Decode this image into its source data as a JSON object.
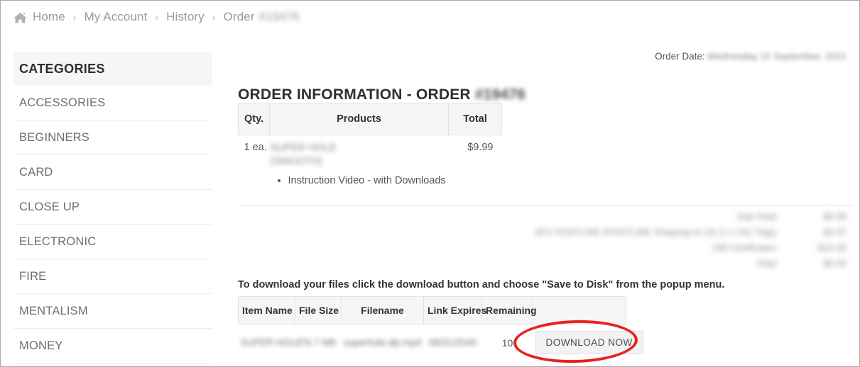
{
  "breadcrumb": {
    "home_icon": "home-icon",
    "separator": "›",
    "items": [
      {
        "label": "Home"
      },
      {
        "label": "My Account"
      },
      {
        "label": "History"
      }
    ],
    "current_label": "Order",
    "current_value_redacted": "#19476"
  },
  "sidebar": {
    "title": "CATEGORIES",
    "items": [
      {
        "label": "ACCESSORIES"
      },
      {
        "label": "BEGINNERS"
      },
      {
        "label": "CARD"
      },
      {
        "label": "CLOSE UP"
      },
      {
        "label": "ELECTRONIC"
      },
      {
        "label": "FIRE"
      },
      {
        "label": "MENTALISM"
      },
      {
        "label": "MONEY"
      }
    ]
  },
  "main": {
    "order_date_label": "Order Date:",
    "order_date_value_redacted": "Wednesday 15 September, 2021",
    "title": "ORDER INFORMATION - ORDER",
    "order_number_redacted": "#19476",
    "products_table": {
      "headers": [
        "Qty.",
        "Products",
        "Total"
      ],
      "rows": [
        {
          "qty": "1 ea.",
          "product_name_redacted_line1": "SUPER HOLE",
          "product_name_redacted_line2": "(SMOOTH)",
          "total": "$9.99",
          "sub_items": [
            "Instruction Video - with Downloads"
          ]
        }
      ]
    },
    "totals": [
      {
        "label_redacted": "Sub-Total:",
        "value_redacted": "$9.99"
      },
      {
        "label_redacted": "4PX POSTLINK (POSTLINK Shipping to US (1 x 102.70g)):",
        "value_redacted": "$4.37"
      },
      {
        "label_redacted": "Gift Certificates:",
        "value_redacted": "-$14.36"
      },
      {
        "label_redacted": "Total:",
        "value_redacted": "$0.00"
      }
    ],
    "download_note": "To download your files click the download button and choose \"Save to Disk\" from the popup menu.",
    "downloads_table": {
      "headers": [
        "Item Name",
        "File Size",
        "Filename",
        "Link Expires",
        "Remaining",
        ""
      ],
      "rows": [
        {
          "item_name_redacted": "SUPER HOLE",
          "file_size_redacted": "76.7 MB",
          "filename_redacted": "superhole-djv.mp4",
          "link_expires_redacted": "08/31/2040",
          "remaining": "10",
          "action_label": "DOWNLOAD NOW"
        }
      ]
    }
  },
  "annotation": {
    "shape": "ellipse",
    "color": "#e8221f",
    "target": "DOWNLOAD NOW"
  }
}
